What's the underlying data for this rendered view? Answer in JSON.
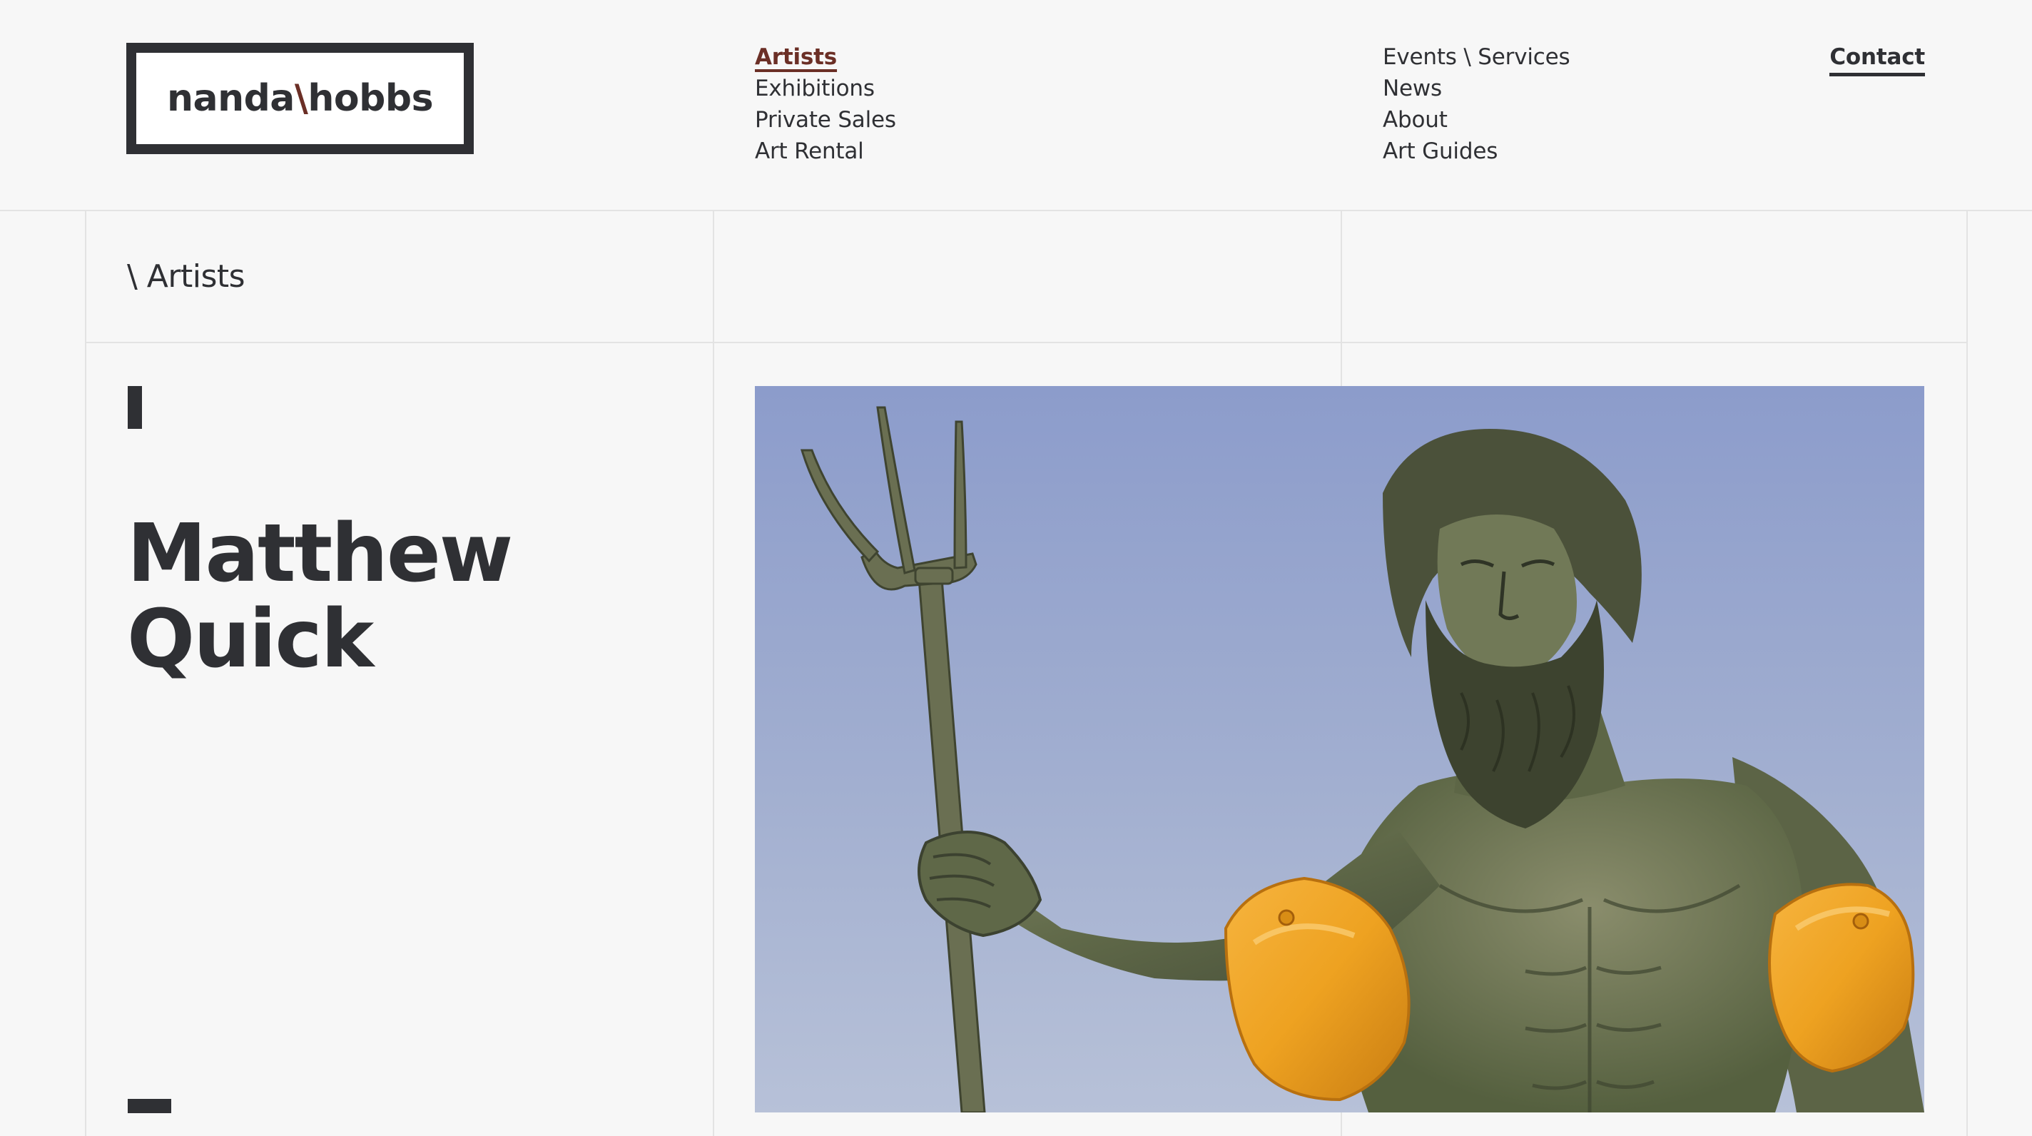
{
  "logo": {
    "left": "nanda",
    "separator": "\\",
    "right": "hobbs"
  },
  "nav": {
    "left_items": [
      {
        "label": "Artists",
        "active": true
      },
      {
        "label": "Exhibitions",
        "active": false
      },
      {
        "label": "Private Sales",
        "active": false
      },
      {
        "label": "Art Rental",
        "active": false
      }
    ],
    "right_items": [
      {
        "label": "Events \\ Services"
      },
      {
        "label": "News"
      },
      {
        "label": "About"
      },
      {
        "label": "Art Guides"
      }
    ],
    "contact": "Contact"
  },
  "breadcrumb": "\\ Artists",
  "artist": {
    "first_name": "Matthew",
    "last_name": "Quick"
  },
  "colors": {
    "accent": "#6b2f26",
    "text": "#2f3034",
    "background": "#f7f7f7",
    "lines": "#e3e3e3"
  }
}
